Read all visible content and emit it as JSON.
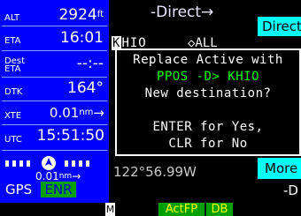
{
  "nav_data": {
    "alt": {
      "label": "ALT",
      "value": "2924",
      "unit": "ft"
    },
    "eta": {
      "label": "ETA",
      "value": "16:01"
    },
    "dest_eta": {
      "label_line1": "Dest",
      "label_line2": "ETA",
      "value": "--:--"
    },
    "dtk": {
      "label": "DTK",
      "value": "164°"
    },
    "xte": {
      "label": "XTE",
      "value": "0.01",
      "unit": "nm",
      "arrow": "→"
    },
    "utc": {
      "label": "UTC",
      "value": "15:51:50"
    },
    "cdi_scale": {
      "value": "0.01",
      "unit": "nm",
      "arrow": "→"
    }
  },
  "mode": {
    "gps": "GPS",
    "enr": "ENR"
  },
  "page": {
    "title": "-Direct→",
    "direct_button": "Direct"
  },
  "identifier": {
    "value": "KHIO",
    "cursor_char": "K",
    "rest": "HIO",
    "filter": "◇ALL"
  },
  "coordinates": "122°56.99W",
  "more_button": "More",
  "bottom_letter": "-D",
  "dialog": {
    "line1": "Replace Active with",
    "line2": "PPOS -D> KHIO",
    "line3": "New destination?",
    "line4": "ENTER for Yes,",
    "line5": "CLR for No"
  },
  "bottom": {
    "m_icon": "M",
    "actfp": "ActFP",
    "db": "DB"
  },
  "colors": {
    "data_panel": "#0000ff",
    "dialog_border": "#ffffff",
    "highlight": "#00ffff",
    "mode_green": "#00a000",
    "dialog_green": "#00ff00",
    "softkey_text": "#ffff00"
  }
}
